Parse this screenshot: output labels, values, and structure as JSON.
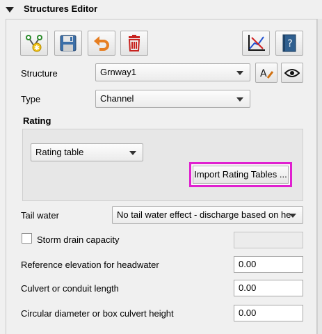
{
  "header": {
    "title": "Structures Editor"
  },
  "toolbar": {
    "buttons": [
      "add-structure-icon",
      "save-icon",
      "undo-icon",
      "delete-icon"
    ],
    "right_buttons": [
      "plot-icon",
      "help-icon"
    ]
  },
  "structure": {
    "label": "Structure",
    "value": "Grnway1"
  },
  "type": {
    "label": "Type",
    "value": "Channel"
  },
  "rating": {
    "heading": "Rating",
    "mode": "Rating table",
    "import_label": "Import Rating Tables ..."
  },
  "tail_water": {
    "label": "Tail water",
    "value": "No tail water effect - discharge based on he"
  },
  "storm_drain": {
    "label": "Storm drain capacity",
    "checked": false,
    "value": ""
  },
  "ref_elev": {
    "label": "Reference elevation for headwater",
    "value": "0.00"
  },
  "culvert_len": {
    "label": "Culvert or conduit length",
    "value": "0.00"
  },
  "diameter": {
    "label": "Circular diameter or box culvert height",
    "value": "0.00"
  },
  "colors": {
    "highlight": "#e020d0",
    "help_blue": "#2f5f8f",
    "delete_red": "#c8231f"
  }
}
